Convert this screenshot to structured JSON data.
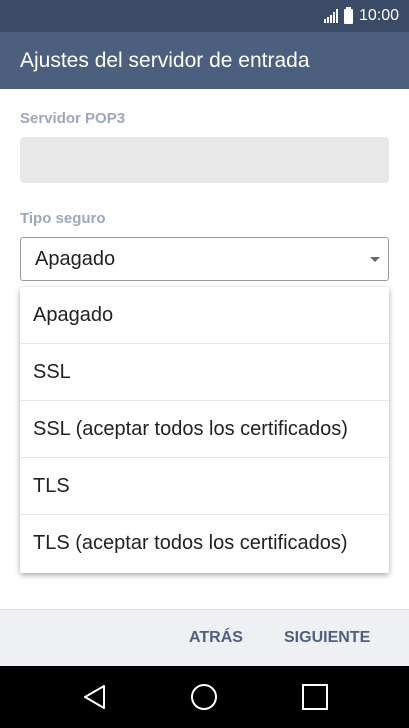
{
  "status_bar": {
    "time": "10:00"
  },
  "app_bar": {
    "title": "Ajustes del servidor de entrada"
  },
  "form": {
    "server_label": "Servidor POP3",
    "server_value": "",
    "security_label": "Tipo seguro",
    "security_selected": "Apagado"
  },
  "dropdown": {
    "options": [
      "Apagado",
      "SSL",
      "SSL (aceptar todos los certificados)",
      "TLS",
      "TLS (aceptar todos los certificados)"
    ]
  },
  "actions": {
    "back_label": "ATRÁS",
    "next_label": "SIGUIENTE"
  },
  "colors": {
    "status_bar": "#3a4a67",
    "app_bar": "#4d5f7e",
    "label": "#9aa9bb",
    "button_text": "#4e6080"
  },
  "icons": {
    "signal": "signal-icon",
    "battery": "battery-icon",
    "back": "back-triangle-icon",
    "home": "home-circle-icon",
    "recents": "recents-square-icon",
    "dropdown": "chevron-down-icon"
  }
}
